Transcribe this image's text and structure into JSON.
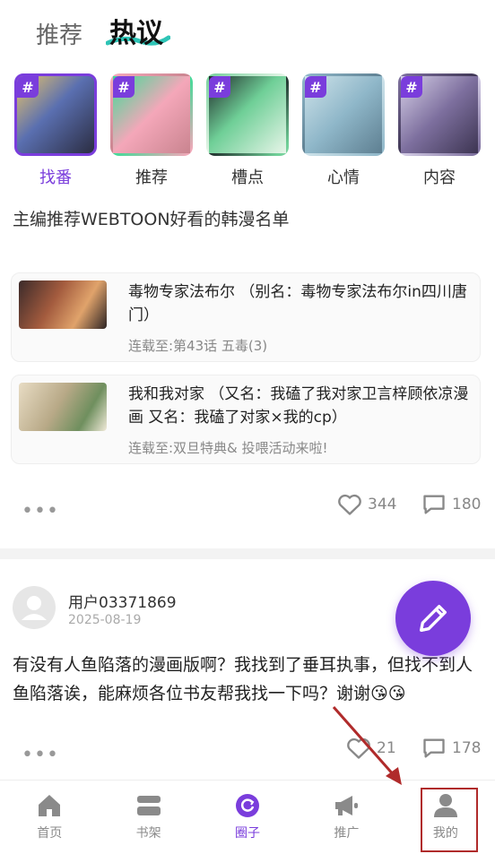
{
  "top_tabs": [
    {
      "label": "推荐",
      "active": false
    },
    {
      "label": "热议",
      "active": true
    }
  ],
  "categories": [
    {
      "label": "找番",
      "active": true
    },
    {
      "label": "推荐",
      "active": false
    },
    {
      "label": "槽点",
      "active": false
    },
    {
      "label": "心情",
      "active": false
    },
    {
      "label": "内容",
      "active": false
    }
  ],
  "category_hash": "#",
  "post1": {
    "title": "主编推荐WEBTOON好看的韩漫名单",
    "comics": [
      {
        "name": "毒物专家法布尔 （别名：毒物专家法布尔in四川唐门）",
        "status": "连载至:第43话 五毒(3)"
      },
      {
        "name": "我和我对家 （又名：我磕了我对家卫言梓顾依凉漫画 又名：我磕了对家×我的cp）",
        "status": "连载至:双旦特典& 投喂活动来啦!"
      }
    ],
    "more": "•••",
    "likes": "344",
    "comments": "180"
  },
  "post2": {
    "user": "用户03371869",
    "date": "2025-08-19",
    "text": "有没有人鱼陷落的漫画版啊？我找到了垂耳执事，但找不到人鱼陷落诶，能麻烦各位书友帮我找一下吗？谢谢😘😘",
    "more": "•••",
    "likes": "21",
    "comments": "178"
  },
  "bottom_nav": [
    {
      "label": "首页",
      "icon": "home-icon",
      "active": false
    },
    {
      "label": "书架",
      "icon": "bookshelf-icon",
      "active": false
    },
    {
      "label": "圈子",
      "icon": "circle-icon",
      "active": true
    },
    {
      "label": "推广",
      "icon": "megaphone-icon",
      "active": false
    },
    {
      "label": "我的",
      "icon": "profile-icon",
      "active": false
    }
  ],
  "colors": {
    "accent": "#7a3ddc",
    "annotation": "#b02b2b"
  }
}
